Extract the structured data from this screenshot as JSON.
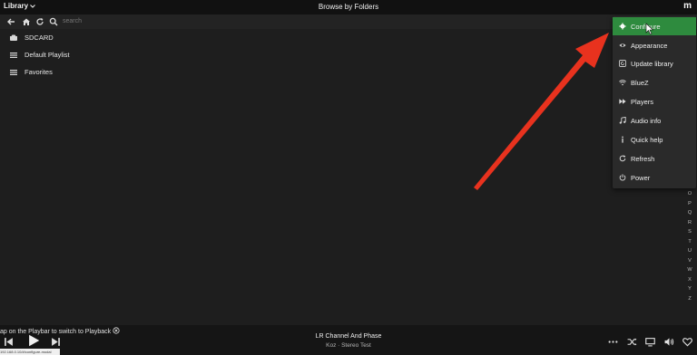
{
  "header": {
    "library_label": "Library",
    "page_title": "Browse by Folders",
    "brand": "m"
  },
  "search": {
    "placeholder": "search"
  },
  "browse_items": [
    {
      "label": "SDCARD",
      "icon": "sdcard-icon"
    },
    {
      "label": "Default Playlist",
      "icon": "list-icon"
    },
    {
      "label": "Favorites",
      "icon": "list-icon"
    }
  ],
  "menu": {
    "items": [
      {
        "label": "Configure",
        "icon": "gear-icon",
        "active": true
      },
      {
        "label": "Appearance",
        "icon": "eye-icon"
      },
      {
        "label": "Update library",
        "icon": "refresh-box-icon"
      },
      {
        "label": "BlueZ",
        "icon": "wifi-icon"
      },
      {
        "label": "Players",
        "icon": "fast-forward-icon"
      },
      {
        "label": "Audio info",
        "icon": "music-note-icon"
      },
      {
        "label": "Quick help",
        "icon": "info-icon"
      },
      {
        "label": "Refresh",
        "icon": "refresh-icon"
      },
      {
        "label": "Power",
        "icon": "power-icon"
      }
    ],
    "active_color": "#2e8b3e"
  },
  "alphabet": [
    "O",
    "P",
    "Q",
    "R",
    "S",
    "T",
    "U",
    "V",
    "W",
    "X",
    "Y",
    "Z"
  ],
  "player": {
    "tip": "ap on the Playbar to switch to Playback",
    "url_hint": "192.168.0.10/#/configure-modal",
    "track_title": "LR Channel And Phase",
    "track_subtitle": "Koz · Stereo Test"
  },
  "annotation": {
    "arrow_color": "#e8321e"
  }
}
